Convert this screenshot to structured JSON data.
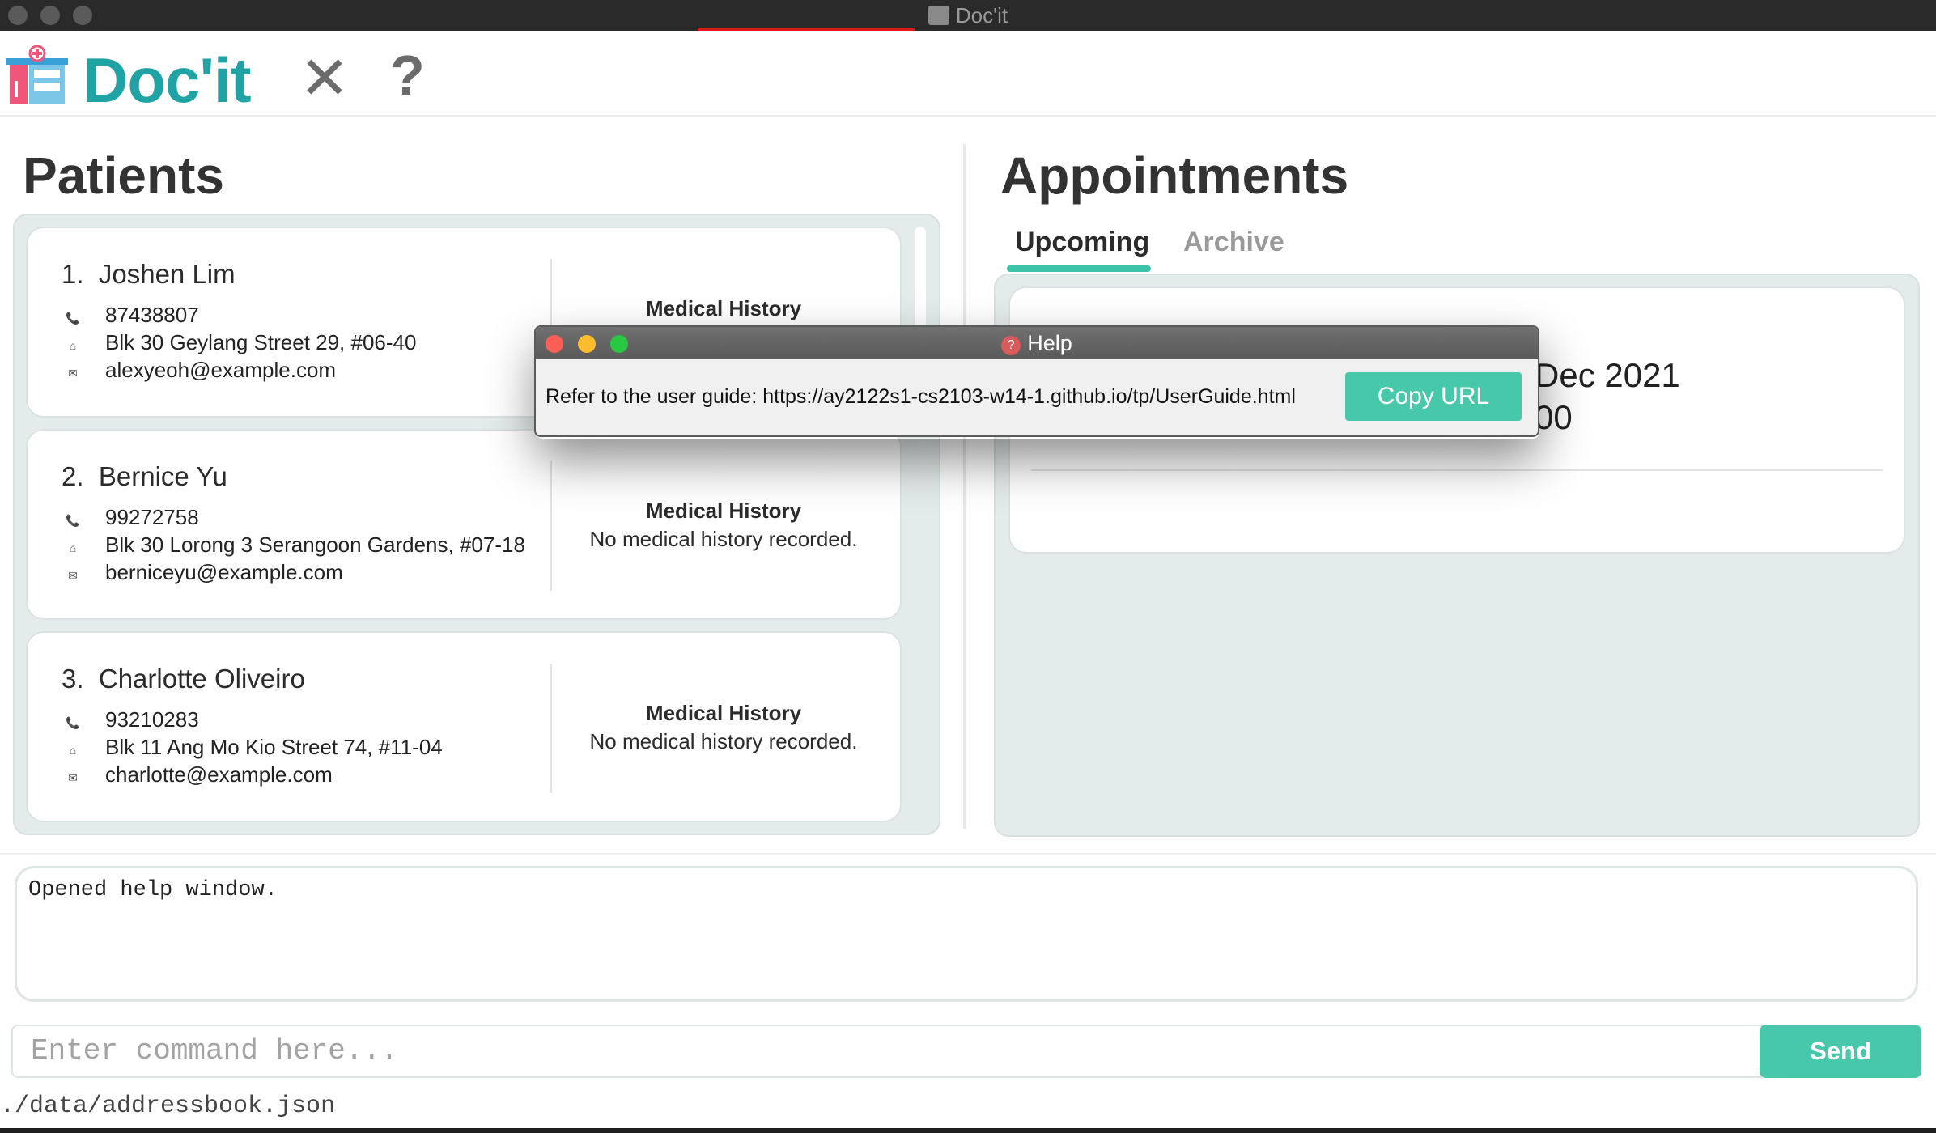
{
  "window": {
    "title": "Doc'it"
  },
  "header": {
    "brand": "Doc'it",
    "exit_icon": "close-icon",
    "help_icon": "help-icon"
  },
  "patients": {
    "heading": "Patients",
    "list": [
      {
        "index": "1.",
        "name": "Joshen Lim",
        "phone": "87438807",
        "address": "Blk 30 Geylang Street 29, #06-40",
        "email": "alexyeoh@example.com",
        "mh_title": "Medical History",
        "mh_text": ""
      },
      {
        "index": "2.",
        "name": "Bernice Yu",
        "phone": "99272758",
        "address": "Blk 30 Lorong 3 Serangoon Gardens, #07-18",
        "email": "berniceyu@example.com",
        "mh_title": "Medical History",
        "mh_text": "No medical history recorded."
      },
      {
        "index": "3.",
        "name": "Charlotte Oliveiro",
        "phone": "93210283",
        "address": "Blk 11 Ang Mo Kio Street 74, #11-04",
        "email": "charlotte@example.com",
        "mh_title": "Medical History",
        "mh_text": "No medical history recorded."
      }
    ]
  },
  "appointments": {
    "heading": "Appointments",
    "tabs": [
      {
        "label": "Upcoming",
        "active": true
      },
      {
        "label": "Archive",
        "active": false
      }
    ],
    "card": {
      "date_partial": "Dec 2021",
      "time_partial": "00"
    }
  },
  "result_display": {
    "text": "Opened help window."
  },
  "command_box": {
    "placeholder": "Enter command here...",
    "value": ""
  },
  "send_button": {
    "label": "Send"
  },
  "status_bar": {
    "path": "./data/addressbook.json"
  },
  "help_dialog": {
    "title": "Help",
    "message": "Refer to the user guide: https://ay2122s1-cs2103-w14-1.github.io/tp/UserGuide.html",
    "copy_label": "Copy URL"
  },
  "colors": {
    "accent": "#47c8aa",
    "brand": "#1fa3a5",
    "panel": "#e4eceb"
  }
}
